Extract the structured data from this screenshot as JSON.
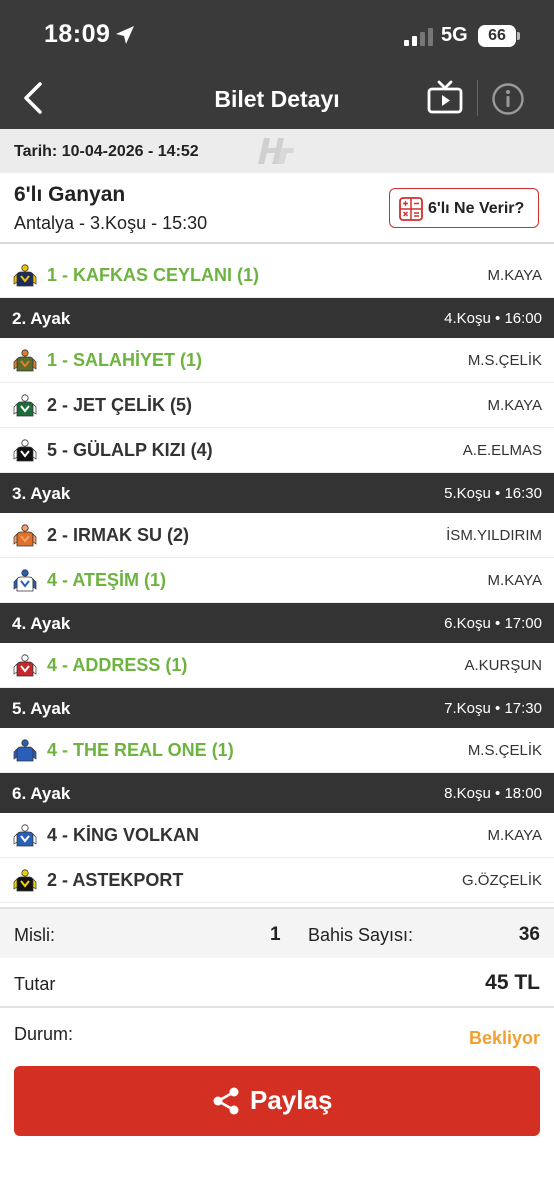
{
  "status_bar": {
    "time": "18:09",
    "network": "5G",
    "battery": "66"
  },
  "header": {
    "title": "Bilet Detayı"
  },
  "date_bar": {
    "text": "Tarih: 10-04-2026 - 14:52"
  },
  "bet": {
    "type": "6'lı Ganyan",
    "race": "Antalya - 3.Koşu - 15:30",
    "ne_verir_label": "6'lı Ne Verir?"
  },
  "legs": [
    {
      "leg": "",
      "race": "",
      "entries": [
        {
          "horse": "1 - KAFKAS CEYLANI (1)",
          "jockey": "M.KAYA",
          "highlight": true,
          "silk": "navy-yellow"
        }
      ]
    },
    {
      "leg": "2. Ayak",
      "race": "4.Koşu • 16:00",
      "entries": [
        {
          "horse": "1 - SALAHİYET (1)",
          "jockey": "M.S.ÇELİK",
          "highlight": true,
          "silk": "olive-orange"
        },
        {
          "horse": "2 - JET ÇELİK (5)",
          "jockey": "M.KAYA",
          "highlight": false,
          "silk": "green-white"
        },
        {
          "horse": "5 - GÜLALP KIZI (4)",
          "jockey": "A.E.ELMAS",
          "highlight": false,
          "silk": "black-white-check"
        }
      ]
    },
    {
      "leg": "3. Ayak",
      "race": "5.Koşu • 16:30",
      "entries": [
        {
          "horse": "2 - IRMAK SU (2)",
          "jockey": "İSM.YILDIRIM",
          "highlight": false,
          "silk": "orange"
        },
        {
          "horse": "4 - ATEŞİM (1)",
          "jockey": "M.KAYA",
          "highlight": true,
          "silk": "blue-white"
        }
      ]
    },
    {
      "leg": "4. Ayak",
      "race": "6.Koşu • 17:00",
      "entries": [
        {
          "horse": "4 - ADDRESS (1)",
          "jockey": "A.KURŞUN",
          "highlight": true,
          "silk": "red-white"
        }
      ]
    },
    {
      "leg": "5. Ayak",
      "race": "7.Koşu • 17:30",
      "entries": [
        {
          "horse": "4 - THE REAL ONE (1)",
          "jockey": "M.S.ÇELİK",
          "highlight": true,
          "silk": "blue"
        }
      ]
    },
    {
      "leg": "6. Ayak",
      "race": "8.Koşu • 18:00",
      "entries": [
        {
          "horse": "4 - KİNG VOLKAN",
          "jockey": "M.KAYA",
          "highlight": false,
          "silk": "blue-white-stripe"
        },
        {
          "horse": "2 - ASTEKPORT",
          "jockey": "G.ÖZÇELİK",
          "highlight": false,
          "silk": "black-yellow"
        }
      ]
    }
  ],
  "summary": {
    "misli_label": "Misli:",
    "misli_value": "1",
    "bahis_label": "Bahis Sayısı:",
    "bahis_value": "36",
    "tutar_label": "Tutar",
    "tutar_value": "45 TL",
    "durum_label": "Durum:",
    "durum_value": "Bekliyor"
  },
  "share_button": {
    "label": "Paylaş"
  },
  "colors": {
    "accent_red": "#d32f23",
    "winner_green": "#6db33f",
    "pending_orange": "#f0a030",
    "header_dark": "#3a3a3a"
  }
}
